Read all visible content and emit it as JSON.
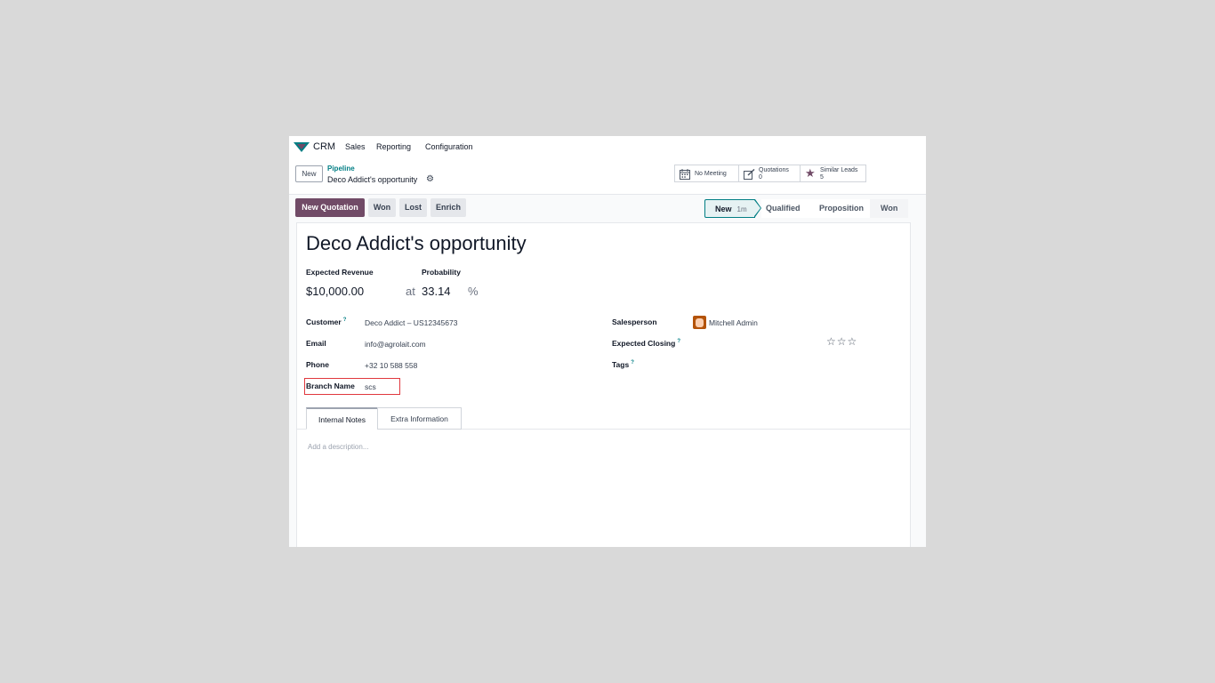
{
  "topnav": {
    "app_name": "CRM",
    "menu": [
      "Sales",
      "Reporting",
      "Configuration"
    ]
  },
  "control_panel": {
    "new_button": "New",
    "breadcrumb_parent": "Pipeline",
    "breadcrumb_current": "Deco Addict's opportunity",
    "smart_buttons": {
      "meeting": {
        "label": "No Meeting"
      },
      "quotations": {
        "label": "Quotations",
        "count": "0"
      },
      "similar": {
        "label": "Similar Leads",
        "count": "5"
      }
    }
  },
  "actions": {
    "new_quotation": "New Quotation",
    "won": "Won",
    "lost": "Lost",
    "enrich": "Enrich"
  },
  "statusbar": {
    "stages": [
      "New",
      "Qualified",
      "Proposition",
      "Won"
    ],
    "active_duration": "1m"
  },
  "form": {
    "title": "Deco Addict's opportunity",
    "expected_revenue_label": "Expected Revenue",
    "expected_revenue": "$10,000.00",
    "at_label": "at",
    "probability_label": "Probability",
    "probability": "33.14",
    "percent": "%",
    "customer_label": "Customer",
    "customer": "Deco Addict – US12345673",
    "email_label": "Email",
    "email": "info@agrolait.com",
    "phone_label": "Phone",
    "phone": "+32 10 588 558",
    "branch_label": "Branch Name",
    "branch": "scs",
    "salesperson_label": "Salesperson",
    "salesperson": "Mitchell Admin",
    "expected_closing_label": "Expected Closing",
    "tags_label": "Tags",
    "help_mark": "?",
    "priority_stars": "☆☆☆"
  },
  "tabs": {
    "notes": "Internal Notes",
    "extra": "Extra Information"
  },
  "description_placeholder": "Add a description...",
  "colors": {
    "brand": "#714b67",
    "accent": "#017e84",
    "highlight": "#e0383e"
  }
}
